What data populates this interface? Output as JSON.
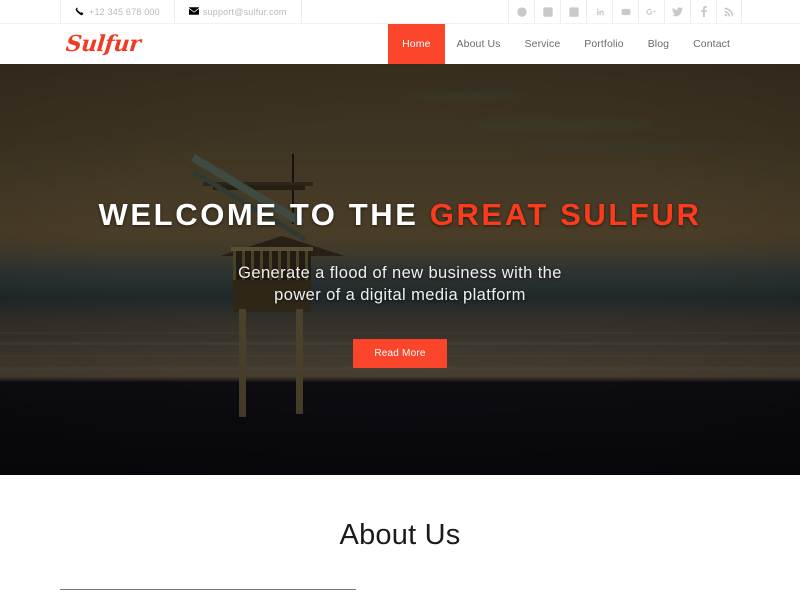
{
  "topbar": {
    "phone": {
      "icon": "phone-icon",
      "text": "+12 345 678 000"
    },
    "email": {
      "icon": "envelope-icon",
      "text": "support@sulfur.com"
    },
    "social": [
      {
        "name": "skype-icon",
        "label": "Skype"
      },
      {
        "name": "vimeo-icon",
        "label": "Vimeo"
      },
      {
        "name": "flickr-icon",
        "label": "Flickr"
      },
      {
        "name": "linkedin-icon",
        "label": "LinkedIn"
      },
      {
        "name": "youtube-icon",
        "label": "YouTube"
      },
      {
        "name": "googleplus-icon",
        "label": "Google Plus"
      },
      {
        "name": "twitter-icon",
        "label": "Twitter"
      },
      {
        "name": "facebook-icon",
        "label": "Facebook"
      },
      {
        "name": "rss-icon",
        "label": "RSS"
      }
    ]
  },
  "header": {
    "logo": "Sulfur",
    "nav": [
      {
        "label": "Home",
        "active": true
      },
      {
        "label": "About Us",
        "active": false
      },
      {
        "label": "Service",
        "active": false
      },
      {
        "label": "Portfolio",
        "active": false
      },
      {
        "label": "Blog",
        "active": false
      },
      {
        "label": "Contact",
        "active": false
      }
    ]
  },
  "hero": {
    "title_white": "WELCOME TO THE ",
    "title_accent": "GREAT SULFUR",
    "subtitle_line1": "Generate a flood of new business with the",
    "subtitle_line2": "power of a digital media platform",
    "button_label": "Read More",
    "background_alt": "beach lifeguard tower at dusk"
  },
  "about": {
    "title": "About Us"
  },
  "colors": {
    "accent": "#fb452a",
    "logo": "#ef3b26",
    "title_accent": "#fb3b1e",
    "nav_text": "#6a6a6a",
    "topbar_text": "#b9b9b9",
    "rule": "#717b86",
    "about_title": "#1b1b1b"
  }
}
